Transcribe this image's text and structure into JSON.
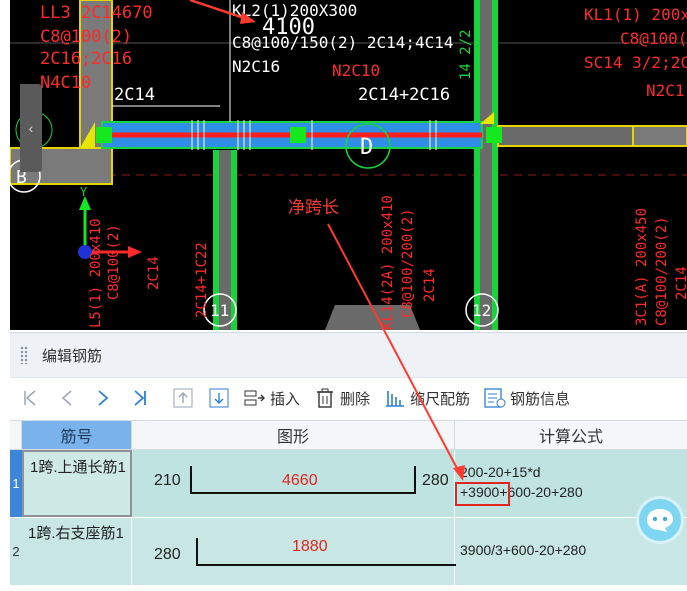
{
  "cad": {
    "texts": {
      "ll3": "LL3 2C14670",
      "c8at100": "C8@100(2)",
      "c2c16": "2C16;2C16",
      "n4c10": "N4C10",
      "kl2_spec": "KL2(1)200X300",
      "dim_4100": "4100",
      "c8at_150": "C8@100/150(2) 2C14;4C14",
      "n2c16": "N2C16",
      "n2c10": "N2C10",
      "top_2c14": "2C14",
      "top_2c14_2c16": "2C14+2C16",
      "kl1_spec": "KL1(1) 200x4",
      "c8_100_right": "C8@100(2",
      "sc14": "SC14 3/2;2C1",
      "n2c1": "N2C1",
      "axis_d": "D",
      "axis_b": "B",
      "axis_11": "11",
      "axis_12": "12",
      "axis_y": "Y",
      "vert_l1": "L5(1) 200x410",
      "vert_l2": "C8@100(2)",
      "vert_l3": "2C14",
      "vert_2c14_1c22": "2C14+1C22",
      "vert_kl14": "KL14(2A) 200x410",
      "vert_c8_200": "C8@100/200(2)",
      "vert_2c14_b": "2C14",
      "vert_3c1": "3C1(A) 200x450",
      "vert_c8_200b": "C8@100/200(2)",
      "vert_2c14_c": "2C14",
      "vert_14": "14 2/2"
    },
    "annotation_label": "净跨长"
  },
  "panel": {
    "title": "编辑钢筋",
    "toolbar": {
      "insert": "插入",
      "delete": "删除",
      "scale_rebar": "缩尺配筋",
      "rebar_info": "钢筋信息"
    },
    "table": {
      "headers": {
        "name": "筋号",
        "shape": "图形",
        "formula": "计算公式"
      },
      "rows": [
        {
          "row_num": "1",
          "name": "1跨.上通长筋1",
          "left_len": "210",
          "mid_len": "4660",
          "right_len": "280",
          "formula_line1": "200-20+15*d",
          "formula_line2_hl": "+3900",
          "formula_line2_rest": "+600-20+280"
        },
        {
          "row_num": "2",
          "name": "1跨.右支座筋1",
          "left_len": "280",
          "mid_len": "1880",
          "formula_line1": "3900/3+600-20+280"
        }
      ]
    }
  },
  "colors": {
    "beam_green": "#16d43a",
    "beam_blue": "#2f8fe6",
    "highlight_red": "#e0261e",
    "row_bg": "#c7e6e4",
    "header_name_bg": "#7ab3ec"
  }
}
